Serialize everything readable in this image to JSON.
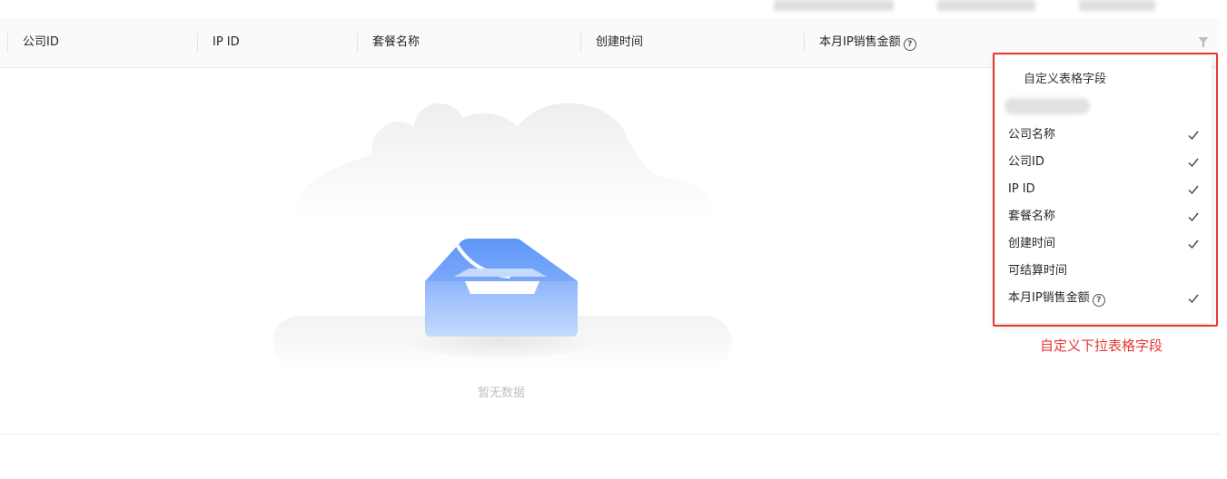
{
  "table": {
    "columns": [
      {
        "label": "公司ID"
      },
      {
        "label": "IP ID"
      },
      {
        "label": "套餐名称"
      },
      {
        "label": "创建时间"
      },
      {
        "label": "本月IP销售金额",
        "help": "?"
      }
    ],
    "empty_text": "暂无数据"
  },
  "dropdown": {
    "title": "自定义表格字段",
    "items": [
      {
        "label": "公司名称",
        "checked": true
      },
      {
        "label": "公司ID",
        "checked": true
      },
      {
        "label": "IP ID",
        "checked": true
      },
      {
        "label": "套餐名称",
        "checked": true
      },
      {
        "label": "创建时间",
        "checked": true
      },
      {
        "label": "可结算时间",
        "checked": false
      },
      {
        "label": "本月IP销售金额",
        "checked": true,
        "help": "?"
      }
    ]
  },
  "annotation": {
    "text": "自定义下拉表格字段",
    "color": "#e53935"
  },
  "icons": {
    "filter": "filter-icon",
    "check": "check-icon",
    "help": "question-circle-icon"
  }
}
